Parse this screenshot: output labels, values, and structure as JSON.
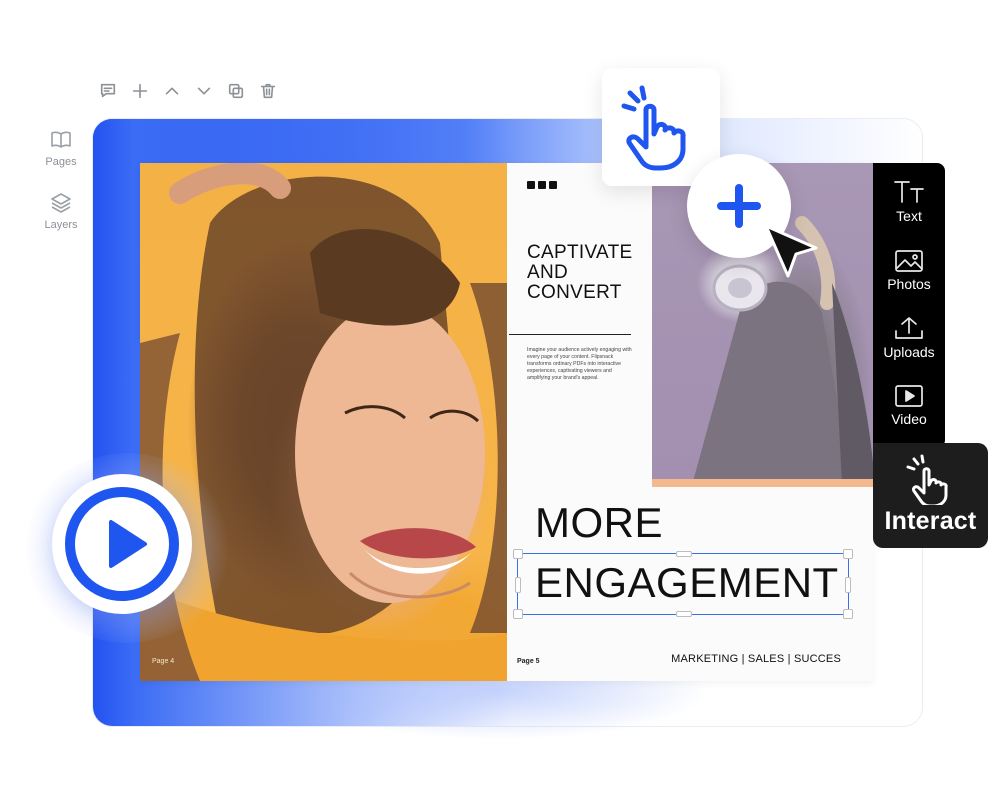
{
  "toolbar": {
    "tools": [
      "comment-icon",
      "plus-icon",
      "chevron-up-icon",
      "chevron-down-icon",
      "duplicate-icon",
      "trash-icon"
    ]
  },
  "left_rail": {
    "items": [
      {
        "label": "Pages",
        "icon": "book-icon"
      },
      {
        "label": "Layers",
        "icon": "layers-icon"
      }
    ]
  },
  "spread": {
    "left_page_number": "Page 4",
    "right_page_number": "Page 5",
    "headline_lines": [
      "CAPTIVATE",
      "AND",
      "CONVERT"
    ],
    "body_copy": "Imagine your audience actively engaging with every page of your content. Flipsnack transforms ordinary PDFs into interactive experiences, captivating viewers and amplifying your brand's appeal.",
    "big_line_1": "MORE",
    "big_line_2": "ENGAGEMENT",
    "footer": "MARKETING | SALES | SUCCES"
  },
  "side_panel": {
    "items": [
      {
        "label": "Text",
        "icon": "text-icon"
      },
      {
        "label": "Photos",
        "icon": "image-icon"
      },
      {
        "label": "Uploads",
        "icon": "upload-icon"
      },
      {
        "label": "Video",
        "icon": "video-icon"
      }
    ],
    "interact_label": "Interact"
  },
  "colors": {
    "accent": "#1f56f0",
    "panel": "#000000"
  }
}
